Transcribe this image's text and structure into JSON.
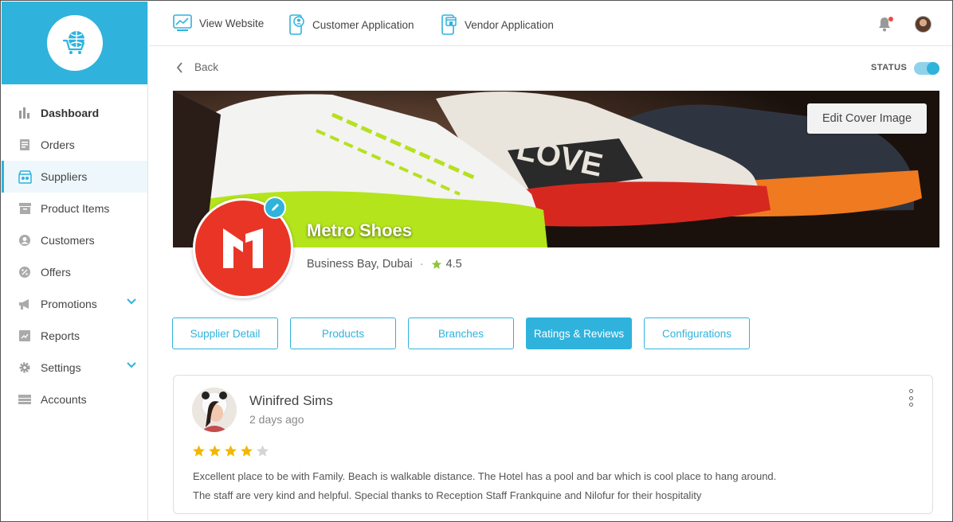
{
  "topbar": {
    "links": [
      {
        "label": "View Website",
        "icon": "monitor-chart-icon"
      },
      {
        "label": "Customer Application",
        "icon": "customer-app-icon"
      },
      {
        "label": "Vendor Application",
        "icon": "vendor-app-icon"
      }
    ],
    "notification_icon": "bell-icon",
    "notification_dot_color": "#ef4b3d"
  },
  "sidebar": {
    "logo_icon": "globe-cart-icon",
    "accent_color": "#2fb3dd",
    "items": [
      {
        "label": "Dashboard",
        "icon": "bar-chart-icon"
      },
      {
        "label": "Orders",
        "icon": "orders-icon"
      },
      {
        "label": "Suppliers",
        "icon": "suppliers-icon",
        "active": true
      },
      {
        "label": "Product Items",
        "icon": "product-items-icon"
      },
      {
        "label": "Customers",
        "icon": "customers-icon"
      },
      {
        "label": "Offers",
        "icon": "percent-icon"
      },
      {
        "label": "Promotions",
        "icon": "megaphone-icon",
        "expandable": true
      },
      {
        "label": "Reports",
        "icon": "reports-icon"
      },
      {
        "label": "Settings",
        "icon": "gear-icon",
        "expandable": true
      },
      {
        "label": "Accounts",
        "icon": "accounts-icon"
      }
    ]
  },
  "page": {
    "back_label": "Back",
    "status_label": "STATUS",
    "status_on": true,
    "edit_cover_label": "Edit Cover Image"
  },
  "supplier": {
    "name": "Metro Shoes",
    "location": "Business Bay, Dubai",
    "separator": "·",
    "rating": "4.5",
    "logo_color": "#e93526"
  },
  "tabs": [
    {
      "label": "Supplier Detail",
      "active": false
    },
    {
      "label": "Products",
      "active": false
    },
    {
      "label": "Branches",
      "active": false
    },
    {
      "label": "Ratings & Reviews",
      "active": true
    },
    {
      "label": "Configurations",
      "active": false
    }
  ],
  "review": {
    "author": "Winifred Sims",
    "time": "2 days ago",
    "stars": 4,
    "max_stars": 5,
    "star_color": "#f2b705",
    "lines": [
      "Excellent place to be with Family. Beach is walkable distance. The Hotel has a pool and bar which is cool place to hang around.",
      "The staff are very kind and helpful. Special thanks to Reception Staff Frankquine and Nilofur for their hospitality"
    ]
  }
}
